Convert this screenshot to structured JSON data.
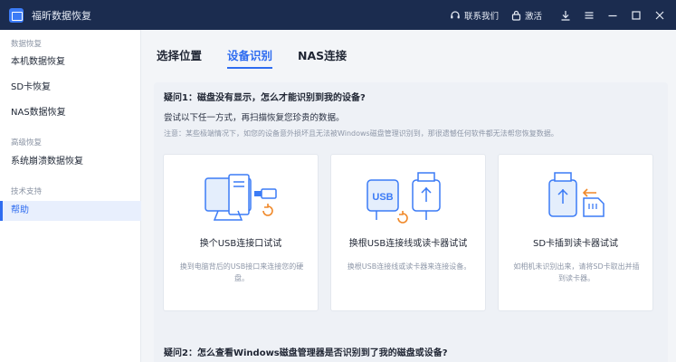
{
  "app": {
    "title": "福昕数据恢复"
  },
  "titlebar": {
    "contact": "联系我们",
    "activate": "激活"
  },
  "sidebar": {
    "sections": [
      {
        "title": "数据恢复",
        "items": [
          {
            "label": "本机数据恢复"
          },
          {
            "label": "SD卡恢复"
          },
          {
            "label": "NAS数据恢复"
          }
        ]
      },
      {
        "title": "高级恢复",
        "items": [
          {
            "label": "系统崩溃数据恢复"
          }
        ]
      },
      {
        "title": "技术支持",
        "items": [
          {
            "label": "帮助"
          }
        ]
      }
    ],
    "active_item": "帮助"
  },
  "tabs": [
    {
      "label": "选择位置"
    },
    {
      "label": "设备识别"
    },
    {
      "label": "NAS连接"
    }
  ],
  "active_tab": "设备识别",
  "question1": {
    "title": "疑问1：磁盘没有显示，怎么才能识别到我的设备?",
    "subtitle": "尝试以下任一方式，再扫描恢复您珍贵的数据。",
    "note": "注意：某些极端情况下，如您的设备意外损坏且无法被Windows磁盘管理识别到，那很遗憾任何软件都无法帮您恢复数据。"
  },
  "cards": [
    {
      "icon": "computer-usb-port-icon",
      "title": "换个USB连接口试试",
      "desc": "换到电脑背后的USB接口来连接您的硬盘。"
    },
    {
      "icon": "usb-cable-swap-icon",
      "title": "换根USB连接线或读卡器试试",
      "desc": "换根USB连接线或读卡器来连接设备。"
    },
    {
      "icon": "sd-card-reader-icon",
      "title": "SD卡插到读卡器试试",
      "desc": "如相机未识别出来，请将SD卡取出并插到读卡器。"
    }
  ],
  "question2": {
    "title": "疑问2：怎么查看Windows磁盘管理器是否识别到了我的磁盘或设备?"
  },
  "colors": {
    "titlebar": "#1b2c4f",
    "accent": "#2e6cf0",
    "orange": "#f0892a"
  }
}
